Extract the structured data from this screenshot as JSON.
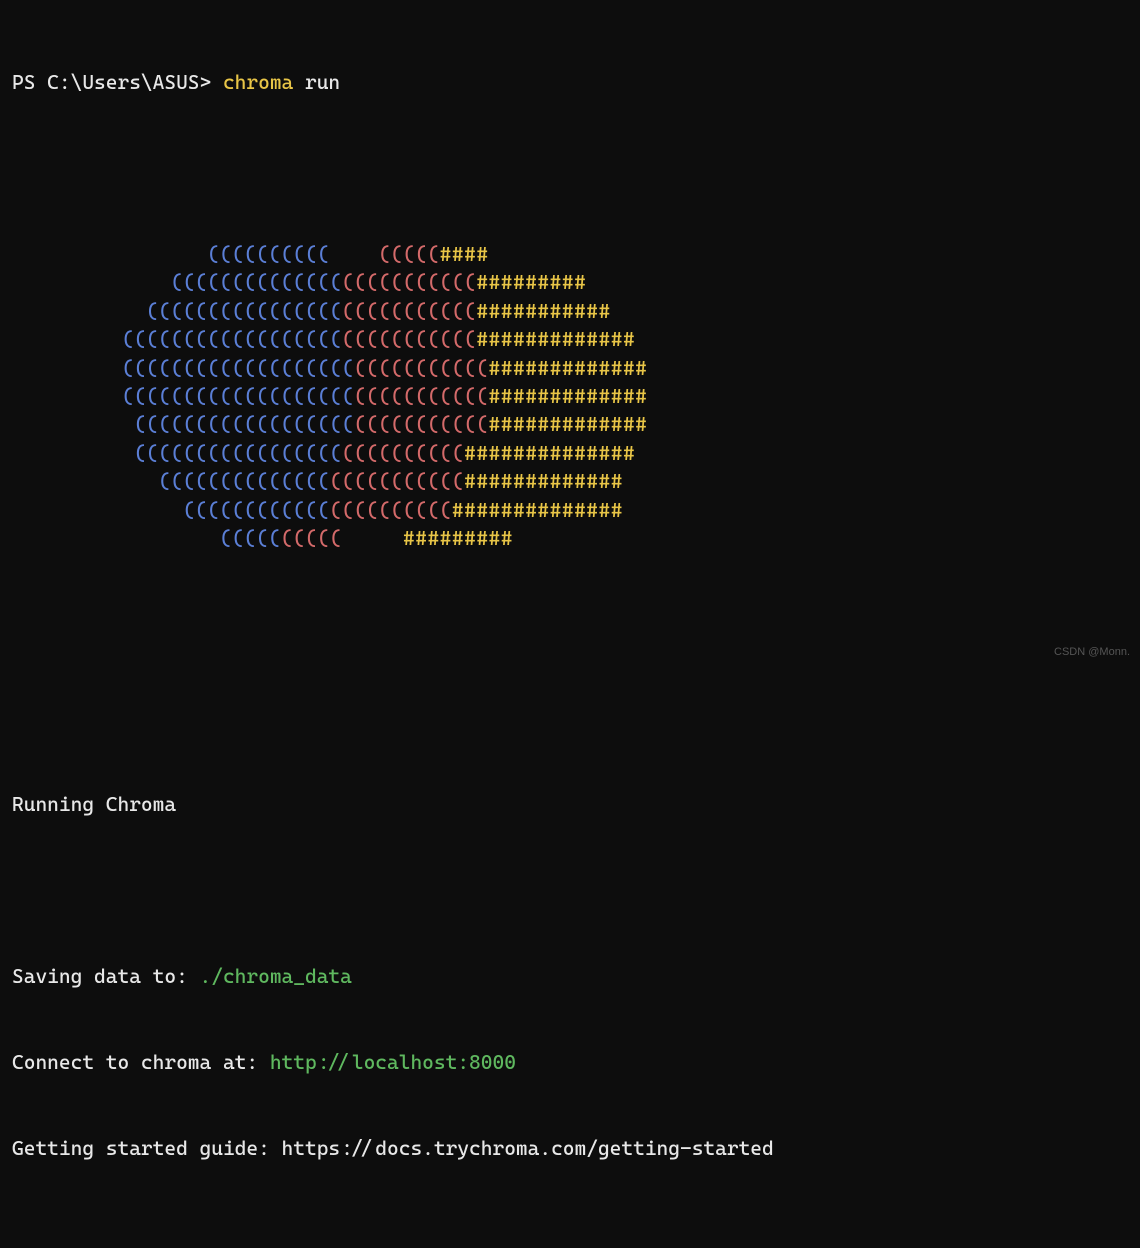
{
  "prompt": {
    "prefix": "PS C:\\Users\\ASUS> ",
    "command_name": "chroma",
    "command_arg": " run"
  },
  "ascii_lines": [
    {
      "pad": "                ",
      "blue": "((((((((((    ",
      "red": "(((((",
      "yellow": "####"
    },
    {
      "pad": "             ",
      "blue": "((((((((((((((",
      "red": "(((((((((((",
      "yellow": "#########"
    },
    {
      "pad": "           ",
      "blue": "((((((((((((((((",
      "red": "(((((((((((",
      "yellow": "###########"
    },
    {
      "pad": "         ",
      "blue": "((((((((((((((((((",
      "red": "(((((((((((",
      "yellow": "#############"
    },
    {
      "pad": "         ",
      "blue": "(((((((((((((((((((",
      "red": "(((((((((((",
      "yellow": "#############"
    },
    {
      "pad": "         ",
      "blue": "(((((((((((((((((((",
      "red": "(((((((((((",
      "yellow": "#############"
    },
    {
      "pad": "          ",
      "blue": "((((((((((((((((((",
      "red": "(((((((((((",
      "yellow": "#############"
    },
    {
      "pad": "          ",
      "blue": "(((((((((((((((((",
      "red": "((((((((((",
      "yellow": "##############"
    },
    {
      "pad": "            ",
      "blue": "((((((((((((((",
      "red": "(((((((((((",
      "yellow": "#############"
    },
    {
      "pad": "              ",
      "blue": "((((((((((((",
      "red": "((((((((((",
      "yellow": "##############"
    },
    {
      "pad": "                 ",
      "blue": "(((((",
      "red": "(((((     ",
      "yellow": "#########"
    }
  ],
  "status": {
    "title": "Running Chroma",
    "saving_label": "Saving data to: ",
    "saving_value": "./chroma_data",
    "connect_label": "Connect to chroma at: ",
    "connect_value": "http://localhost:8000",
    "guide_label": "Getting started guide: ",
    "guide_value": "https://docs.trychroma.com/getting-started"
  },
  "watermark": "CSDN @Monn."
}
